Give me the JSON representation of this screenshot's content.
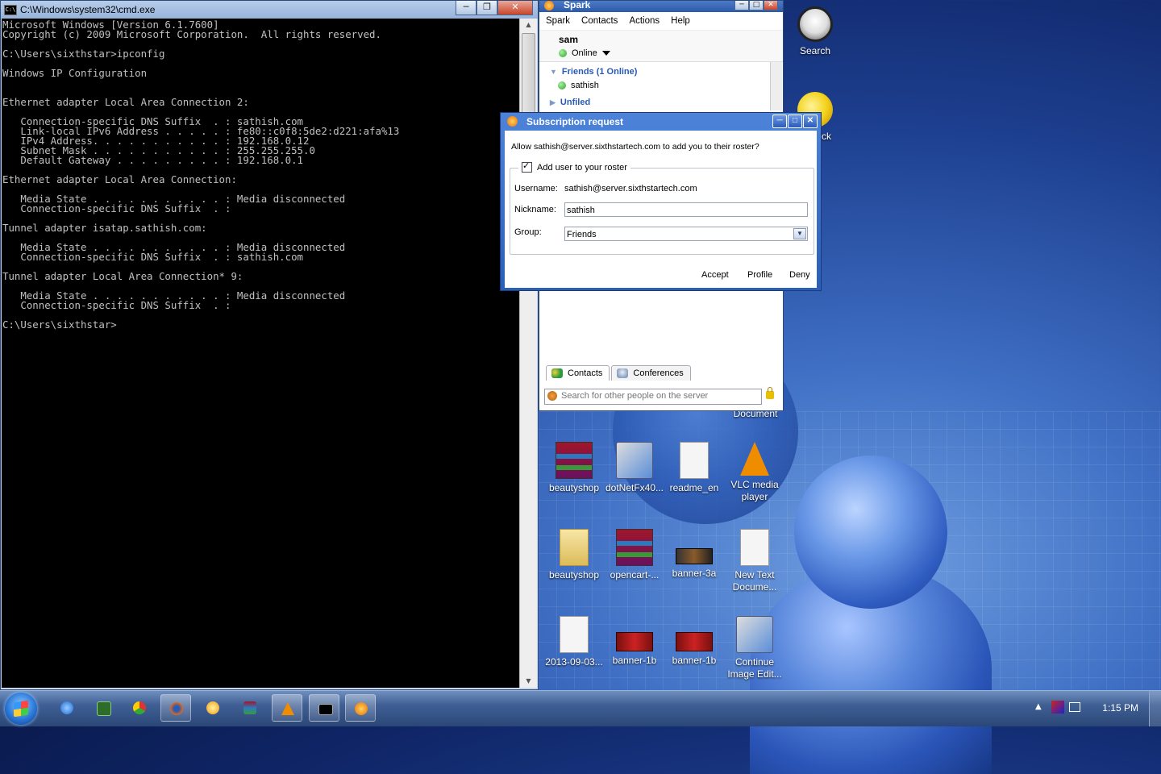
{
  "desktop": {
    "icons": [
      {
        "name": "search",
        "label": "Search"
      },
      {
        "name": "ck",
        "label": "ck"
      },
      {
        "name": "document",
        "label": "Document"
      },
      {
        "name": "beautyshop-rar",
        "label": "beautyshop"
      },
      {
        "name": "dotnetfx40",
        "label": "dotNetFx40..."
      },
      {
        "name": "readme-en",
        "label": "readme_en"
      },
      {
        "name": "vlc",
        "label": "VLC media player"
      },
      {
        "name": "beautyshop-folder",
        "label": "beautyshop"
      },
      {
        "name": "opencart",
        "label": "opencart-..."
      },
      {
        "name": "banner-3a",
        "label": "banner-3a"
      },
      {
        "name": "new-text-document",
        "label": "New Text Docume..."
      },
      {
        "name": "doc-2013",
        "label": "2013-09-03..."
      },
      {
        "name": "banner-1b-a",
        "label": "banner-1b"
      },
      {
        "name": "banner-1b-b",
        "label": "banner-1b"
      },
      {
        "name": "continue-image-edit",
        "label": "Continue Image Edit..."
      }
    ]
  },
  "cmd": {
    "title": "C:\\Windows\\system32\\cmd.exe",
    "output": "Microsoft Windows [Version 6.1.7600]\nCopyright (c) 2009 Microsoft Corporation.  All rights reserved.\n\nC:\\Users\\sixthstar>ipconfig\n\nWindows IP Configuration\n\n\nEthernet adapter Local Area Connection 2:\n\n   Connection-specific DNS Suffix  . : sathish.com\n   Link-local IPv6 Address . . . . . : fe80::c0f8:5de2:d221:afa%13\n   IPv4 Address. . . . . . . . . . . : 192.168.0.12\n   Subnet Mask . . . . . . . . . . . : 255.255.255.0\n   Default Gateway . . . . . . . . . : 192.168.0.1\n\nEthernet adapter Local Area Connection:\n\n   Media State . . . . . . . . . . . : Media disconnected\n   Connection-specific DNS Suffix  . :\n\nTunnel adapter isatap.sathish.com:\n\n   Media State . . . . . . . . . . . : Media disconnected\n   Connection-specific DNS Suffix  . : sathish.com\n\nTunnel adapter Local Area Connection* 9:\n\n   Media State . . . . . . . . . . . : Media disconnected\n   Connection-specific DNS Suffix  . :\n\nC:\\Users\\sixthstar>"
  },
  "spark": {
    "title": "Spark",
    "menu": [
      "Spark",
      "Contacts",
      "Actions",
      "Help"
    ],
    "user": {
      "name": "sam",
      "status": "Online"
    },
    "groups": [
      {
        "label": "Friends (1 Online)",
        "expanded": true,
        "members": [
          {
            "name": "sathish",
            "status": "online"
          }
        ]
      },
      {
        "label": "Unfiled",
        "expanded": false
      }
    ],
    "tabs": [
      "Contacts",
      "Conferences"
    ],
    "search_placeholder": "Search for other people on the server"
  },
  "dialog": {
    "title": "Subscription request",
    "prompt": "Allow sathish@server.sixthstartech.com to add you to their roster?",
    "add_roster_label": "Add user to your roster",
    "add_roster_checked": true,
    "username_label": "Username:",
    "username_value": "sathish@server.sixthstartech.com",
    "nickname_label": "Nickname:",
    "nickname_value": "sathish",
    "group_label": "Group:",
    "group_value": "Friends",
    "buttons": {
      "accept": "Accept",
      "profile": "Profile",
      "deny": "Deny"
    }
  },
  "taskbar": {
    "pinned": [
      "internet-explorer",
      "dreamweaver",
      "chrome",
      "firefox",
      "messenger",
      "winrar",
      "vlc",
      "cmd",
      "spark"
    ],
    "clock": "1:15 PM"
  },
  "colors": {
    "accent": "#2a5ab0",
    "titlebar": "#2c5aa8"
  }
}
